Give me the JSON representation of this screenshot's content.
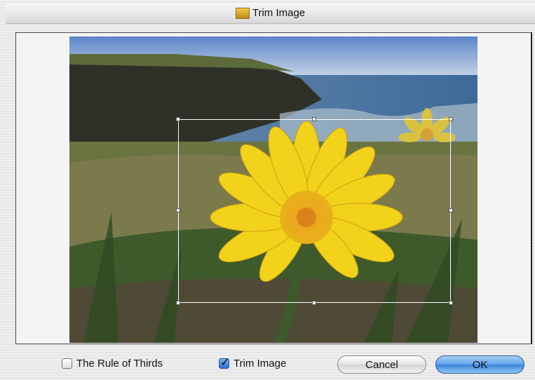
{
  "window": {
    "title": "Trim Image",
    "title_icon": "image-folder-icon"
  },
  "options": {
    "rule_of_thirds": {
      "label": "The Rule of Thirds",
      "checked": false
    },
    "trim_image": {
      "label": "Trim Image",
      "checked": true
    }
  },
  "buttons": {
    "cancel": "Cancel",
    "ok": "OK"
  },
  "colors": {
    "ok_button": "#4a8fe0",
    "crop_border": "#ffffff"
  }
}
